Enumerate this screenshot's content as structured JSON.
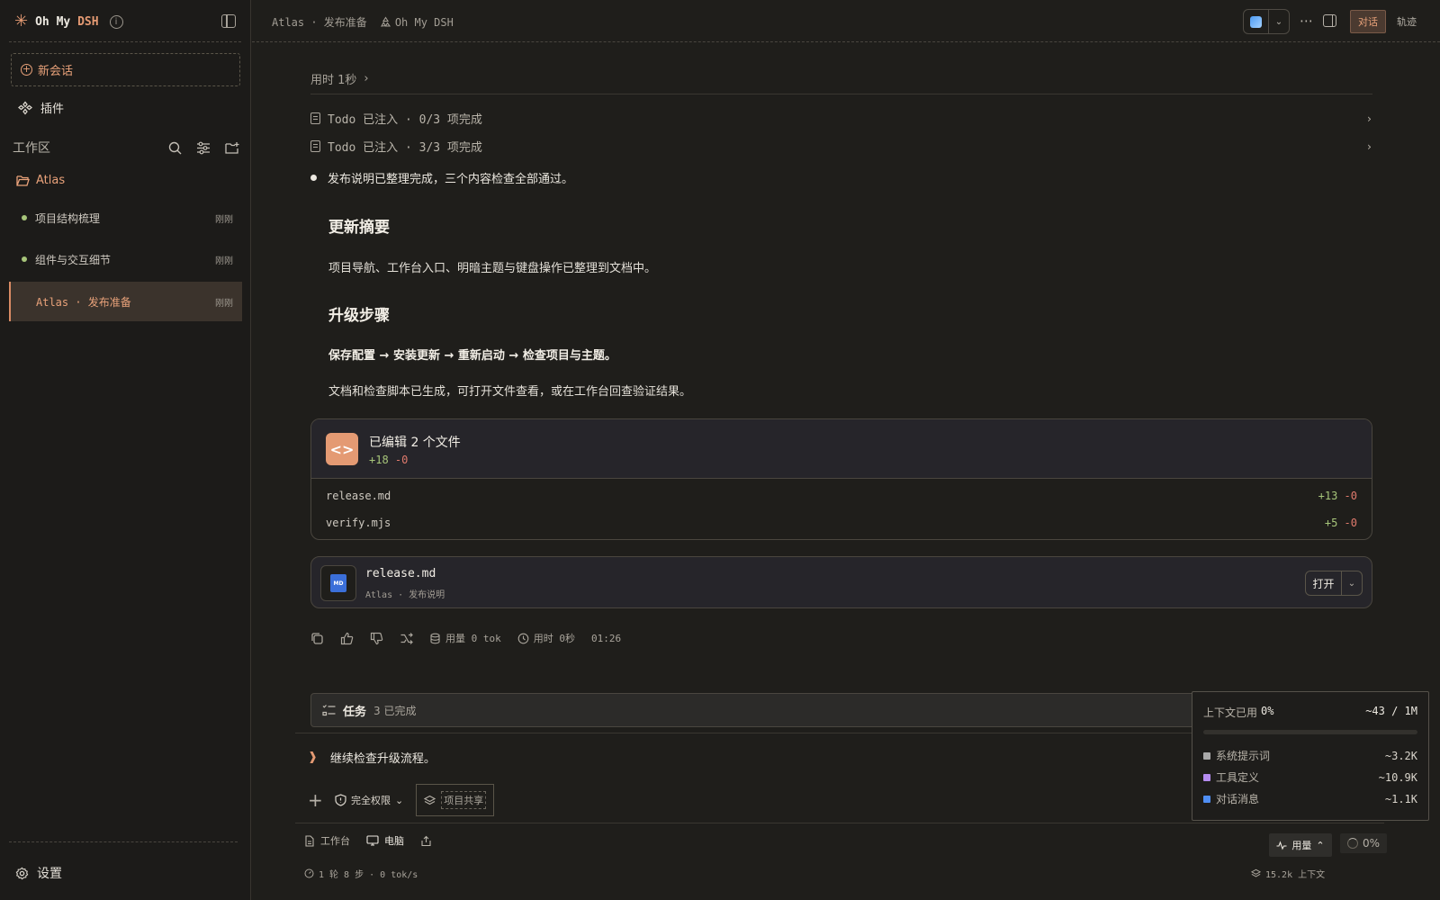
{
  "sidebar": {
    "brand": {
      "prefix": "Oh My",
      "accent": "DSH"
    },
    "new_chat": "新会话",
    "plugins": "插件",
    "workspace_label": "工作区",
    "folder": "Atlas",
    "sessions": [
      {
        "title": "项目结构梳理",
        "time": "刚刚"
      },
      {
        "title": "组件与交互细节",
        "time": "刚刚"
      },
      {
        "title": "Atlas · 发布准备",
        "time": "刚刚"
      }
    ],
    "settings": "设置"
  },
  "topbar": {
    "breadcrumb": "Atlas · 发布准备",
    "project": "Oh My DSH",
    "tab_chat": "对话",
    "tab_trace": "轨迹"
  },
  "main": {
    "timer": "用时 1秒",
    "todos": [
      "Todo 已注入 · 0/3 项完成",
      "Todo 已注入 · 3/3 项完成"
    ],
    "bullet": "发布说明已整理完成，三个内容检查全部通过。",
    "heading1": "更新摘要",
    "para1": "项目导航、工作台入口、明暗主题与键盘操作已整理到文档中。",
    "heading2": "升级步骤",
    "steps": "保存配置 → 安装更新 → 重新启动 → 检查项目与主题。",
    "para2": "文档和检查脚本已生成，可打开文件查看，或在工作台回查验证结果。",
    "edited": {
      "title": "已编辑 2 个文件",
      "add": "+18",
      "del": "-0",
      "files": [
        {
          "name": "release.md",
          "add": "+13",
          "del": "-0"
        },
        {
          "name": "verify.mjs",
          "add": "+5",
          "del": "-0"
        }
      ]
    },
    "doc": {
      "badge": "MD",
      "name": "release.md",
      "sub": "Atlas · 发布说明",
      "open": "打开"
    },
    "actions": {
      "usage": "用量 0 tok",
      "duration": "用时 0秒",
      "clock": "01:26"
    },
    "task": {
      "label": "任务",
      "count": "3 已完成"
    },
    "prompt": "继续检查升级流程。",
    "permission": "完全权限",
    "share": "项目共享",
    "footer": {
      "workbench": "工作台",
      "computer": "电脑",
      "perf": "1 轮 8 步 · 0 tok/s",
      "usage": "用量",
      "pct": "0%",
      "ctx": "15.2k 上下文"
    }
  },
  "popover": {
    "label": "上下文已用",
    "pct": "0%",
    "used_fraction": 0.0,
    "total": "~43 / 1M",
    "items": [
      {
        "name": "系统提示词",
        "value": "~3.2K",
        "color": "#a9a9a9"
      },
      {
        "name": "工具定义",
        "value": "~10.9K",
        "color": "#b58cf0"
      },
      {
        "name": "对话消息",
        "value": "~1.1K",
        "color": "#4f8ef3"
      }
    ]
  },
  "colors": {
    "accent": "#e49a73",
    "add": "#a7c57a",
    "del": "#e07a6d",
    "background": "#1f1e1b"
  }
}
